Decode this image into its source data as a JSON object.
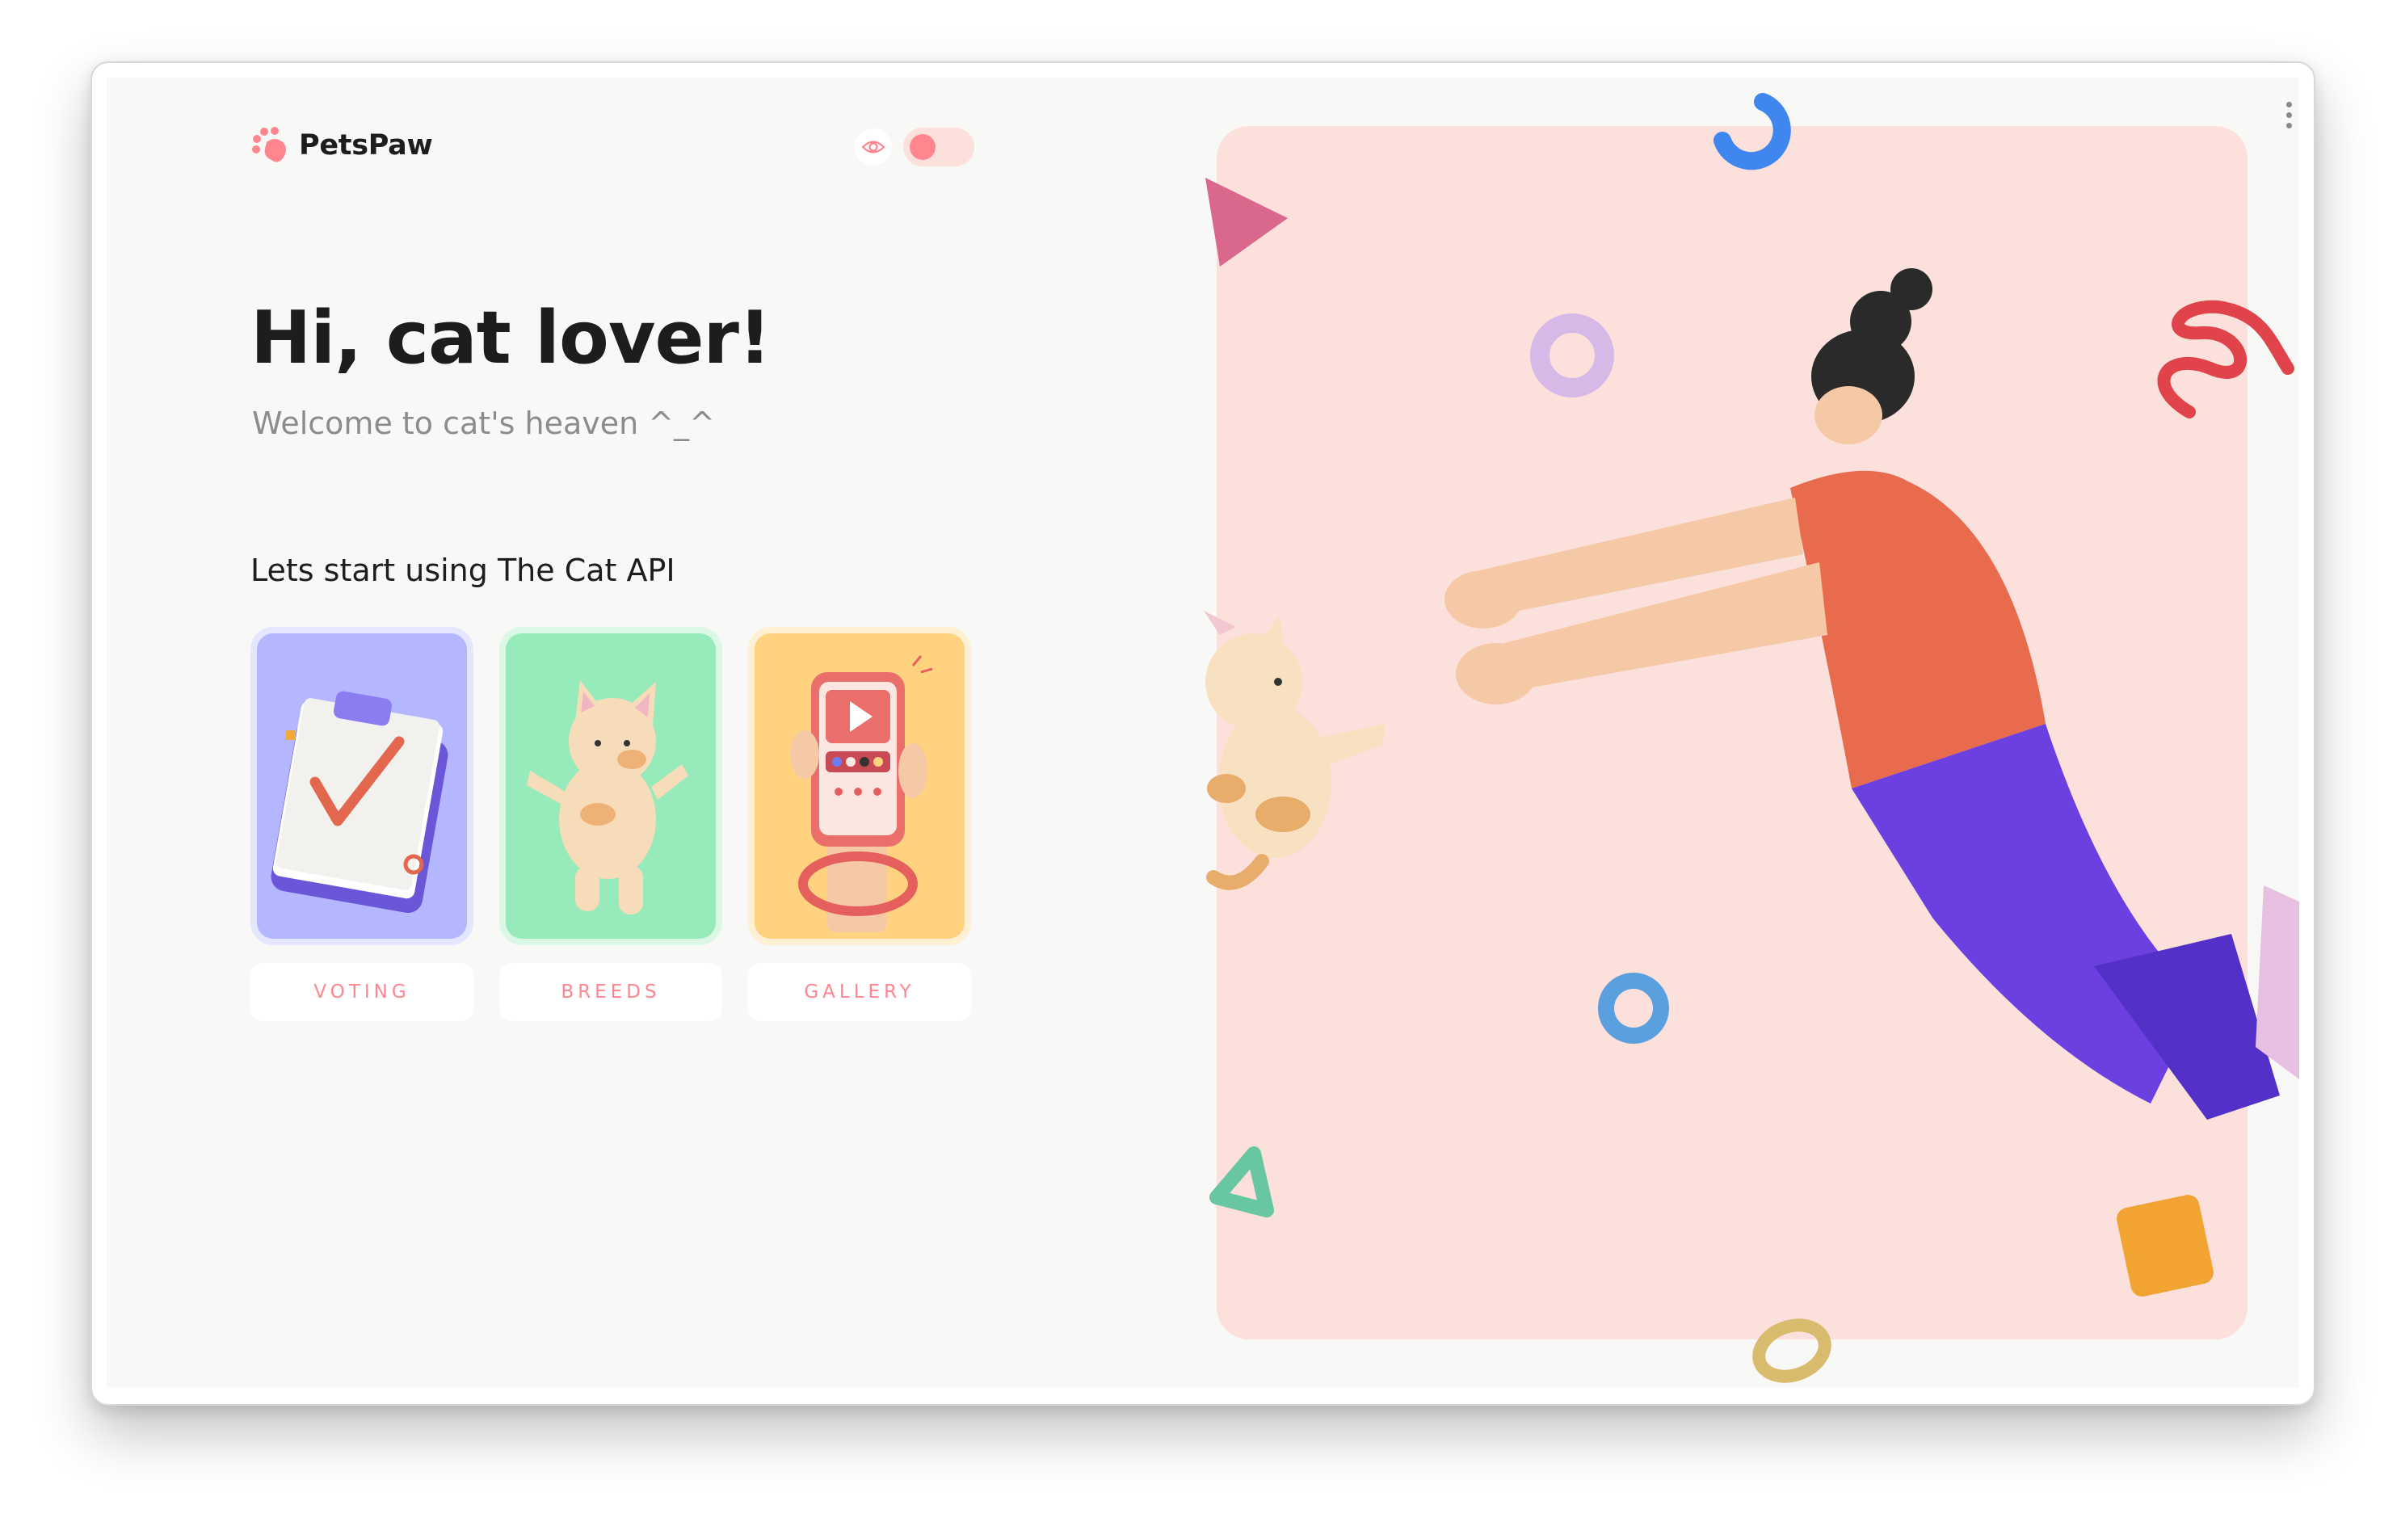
{
  "app": {
    "name": "PetsPaw"
  },
  "hero": {
    "title": "Hi, cat lover!",
    "subtitle": "Welcome to cat's heaven ^_^",
    "section_heading": "Lets start using The Cat API"
  },
  "cards": [
    {
      "label": "VOTING",
      "color": "#b4b7ff",
      "illustration": "clipboard-check-icon"
    },
    {
      "label": "BREEDS",
      "color": "#97eab9",
      "illustration": "cat-icon"
    },
    {
      "label": "GALLERY",
      "color": "#ffd280",
      "illustration": "phone-gallery-icon"
    }
  ],
  "theme": {
    "accent": "#ff868e",
    "toggle_background": "#fbe0dc",
    "panel_background": "#fbe0dc",
    "page_background": "#f8f8f7"
  }
}
